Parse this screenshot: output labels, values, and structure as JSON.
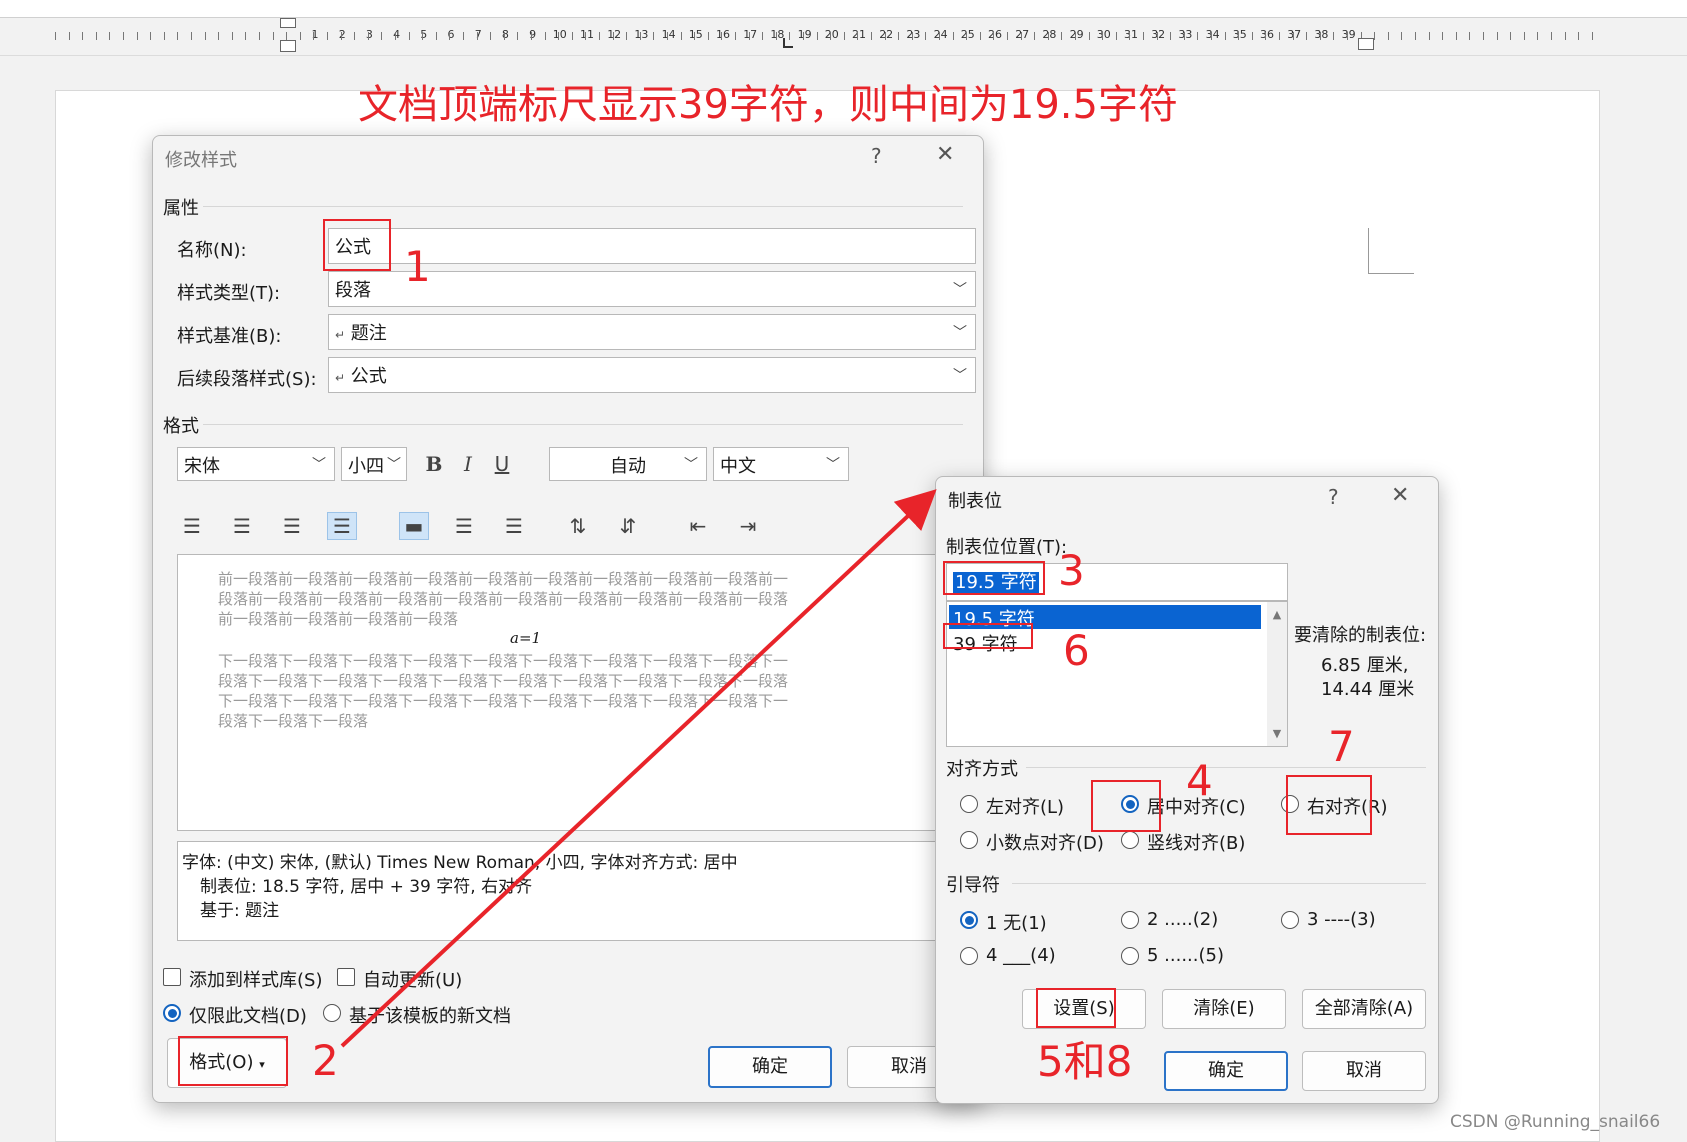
{
  "ruler": {
    "numbers": [
      "1",
      "2",
      "3",
      "4",
      "5",
      "6",
      "7",
      "8",
      "9",
      "10",
      "11",
      "12",
      "13",
      "14",
      "15",
      "16",
      "17",
      "18",
      "19",
      "20",
      "21",
      "22",
      "23",
      "24",
      "25",
      "26",
      "27",
      "28",
      "29",
      "30",
      "31",
      "32",
      "33",
      "34",
      "35",
      "36",
      "37",
      "38",
      "39"
    ]
  },
  "annotation": {
    "title": "文档顶端标尺显示39字符，则中间为19.5字符",
    "step1": "1",
    "step2": "2",
    "step3": "3",
    "step4": "4",
    "step6": "6",
    "step7": "7",
    "step58": "5和8",
    "color": "#e8242a"
  },
  "modify_style": {
    "title": "修改样式",
    "help": "?",
    "close": "✕",
    "properties_group": "属性",
    "name_label": "名称(N):",
    "name_value": "公式",
    "type_label": "样式类型(T):",
    "type_value": "段落",
    "based_label": "样式基准(B):",
    "based_value": "题注",
    "next_label": "后续段落样式(S):",
    "next_value": "公式",
    "format_group": "格式",
    "font_value": "宋体",
    "size_value": "小四",
    "bold": "B",
    "italic": "I",
    "underline": "U",
    "color_value": "自动",
    "script_value": "中文",
    "preview_prev": [
      "前一段落前一段落前一段落前一段落前一段落前一段落前一段落前一段落前一段落前一",
      "段落前一段落前一段落前一段落前一段落前一段落前一段落前一段落前一段落前一段落",
      "前一段落前一段落前一段落前一段落"
    ],
    "preview_formula": "a=1",
    "preview_next": [
      "下一段落下一段落下一段落下一段落下一段落下一段落下一段落下一段落下一段落下一",
      "段落下一段落下一段落下一段落下一段落下一段落下一段落下一段落下一段落下一段落",
      "下一段落下一段落下一段落下一段落下一段落下一段落下一段落下一段落下一段落下一",
      "段落下一段落下一段落"
    ],
    "description": [
      "字体: (中文) 宋体, (默认) Times New Roman, 小四, 字体对齐方式: 居中",
      "制表位:  18.5 字符, 居中 +  39 字符, 右对齐",
      "基于: 题注"
    ],
    "add_to_gallery": "添加到样式库(S)",
    "auto_update": "自动更新(U)",
    "only_this_doc": "仅限此文档(D)",
    "new_docs": "基于该模板的新文档",
    "format_button": "格式(O)",
    "ok": "确定",
    "cancel": "取消"
  },
  "tabs": {
    "title": "制表位",
    "help": "?",
    "close": "✕",
    "position_label": "制表位位置(T):",
    "position_value": "19.5 字符",
    "list_items": [
      "19.5 字符",
      "39 字符"
    ],
    "clear_label": "要清除的制表位:",
    "clear_values": [
      "6.85 厘米,",
      "14.44 厘米"
    ],
    "alignment_group": "对齐方式",
    "align_left": "左对齐(L)",
    "align_center": "居中对齐(C)",
    "align_right": "右对齐(R)",
    "align_decimal": "小数点对齐(D)",
    "align_bar": "竖线对齐(B)",
    "leader_group": "引导符",
    "leader_1": "1 无(1)",
    "leader_2": "2 .....(2)",
    "leader_3": "3 ----(3)",
    "leader_4": "4 ___(4)",
    "leader_5": "5 ......(5)",
    "set": "设置(S)",
    "clear": "清除(E)",
    "clear_all": "全部清除(A)",
    "ok": "确定",
    "cancel": "取消"
  },
  "watermark": "CSDN @Running_snail66"
}
